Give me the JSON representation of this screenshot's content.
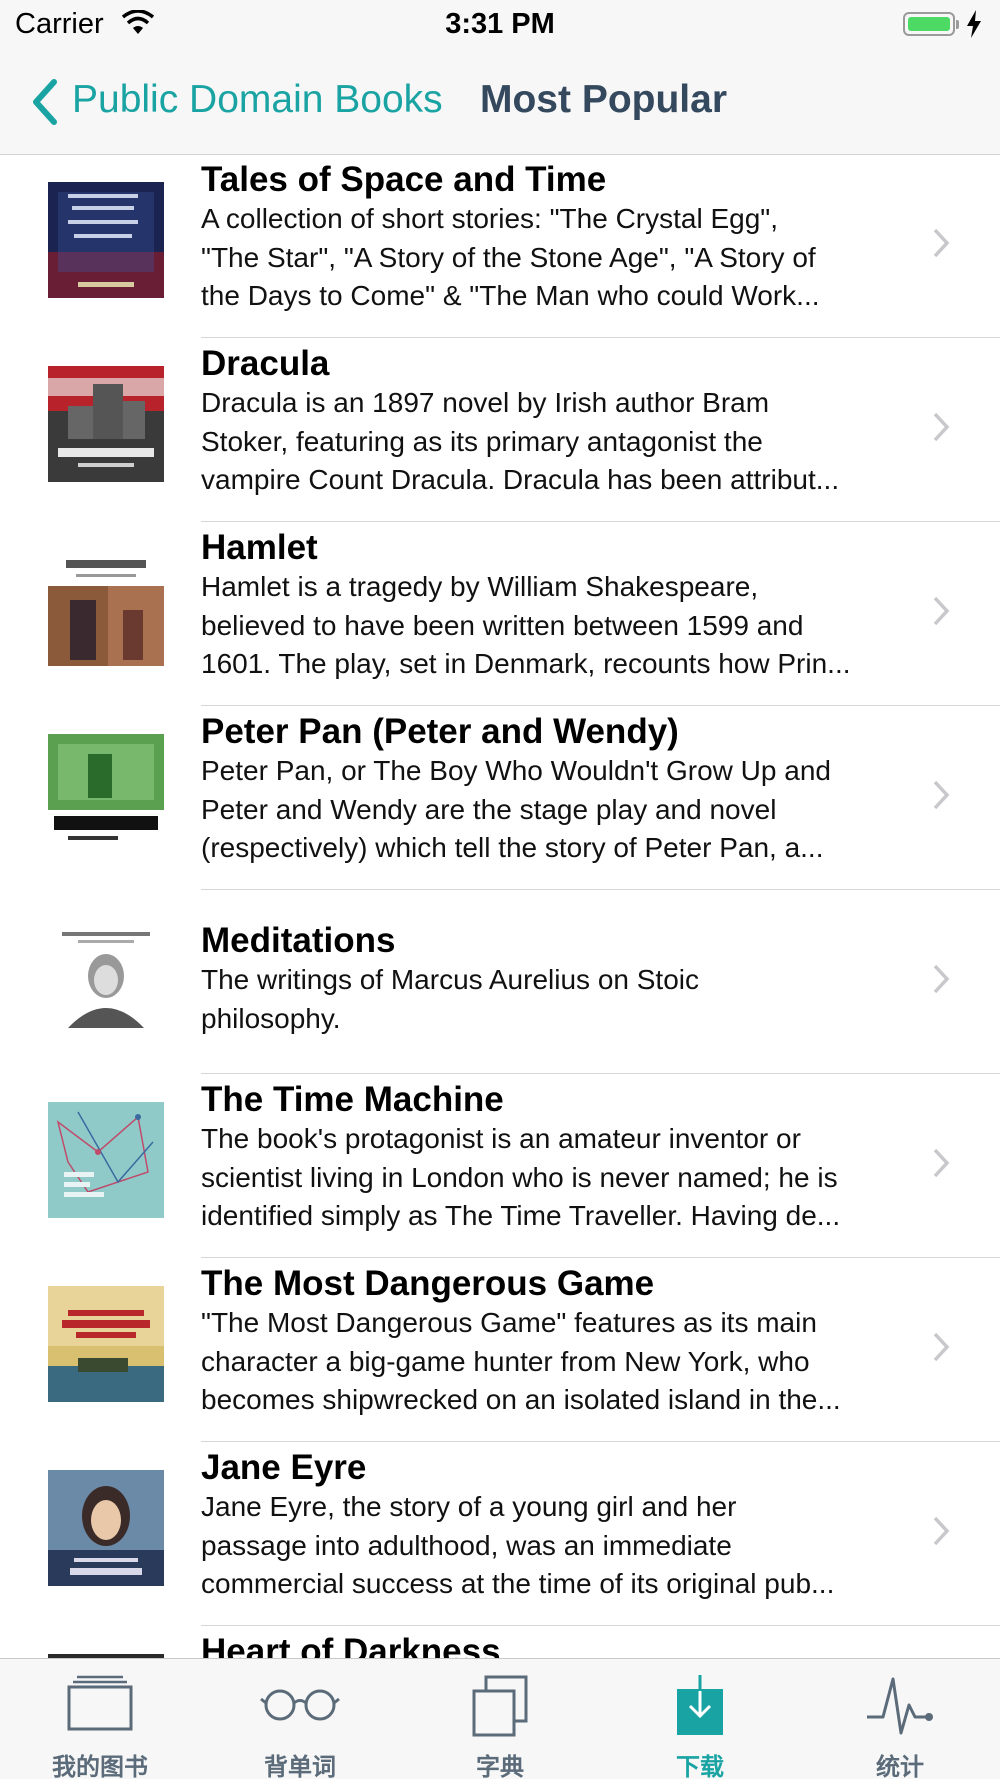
{
  "status_bar": {
    "carrier": "Carrier",
    "time": "3:31 PM"
  },
  "nav": {
    "back_label": "Public Domain Books",
    "title": "Most Popular"
  },
  "books": [
    {
      "title": "Tales of Space and Time",
      "desc": [
        "A collection of short stories: \"The Crystal Egg\",",
        "\"The Star\", \"A Story of the Stone Age\", \"A Story of",
        "the Days to Come\" & \"The Man who could Work..."
      ],
      "cover": "tales-cover"
    },
    {
      "title": "Dracula",
      "desc": [
        "Dracula is an 1897 novel by Irish author Bram",
        "Stoker, featuring as its primary antagonist the",
        "vampire Count Dracula. Dracula has been attribut..."
      ],
      "cover": "dracula-cover"
    },
    {
      "title": "Hamlet",
      "desc": [
        "Hamlet is a tragedy by William Shakespeare,",
        "believed to have been written between 1599 and",
        "1601. The play, set in Denmark, recounts how Prin..."
      ],
      "cover": "hamlet-cover"
    },
    {
      "title": "Peter Pan (Peter and Wendy)",
      "desc": [
        "Peter Pan, or The Boy Who Wouldn't Grow Up and",
        "Peter and Wendy are the stage play and novel",
        "(respectively) which tell the story of Peter Pan, a..."
      ],
      "cover": "peterpan-cover"
    },
    {
      "title": "Meditations",
      "desc": [
        "The writings of Marcus Aurelius on Stoic",
        "philosophy."
      ],
      "cover": "meditations-cover"
    },
    {
      "title": "The Time Machine",
      "desc": [
        "The book's protagonist is an amateur inventor or",
        "scientist living in London who is never named; he is",
        "identified simply as The Time Traveller. Having de..."
      ],
      "cover": "timemachine-cover"
    },
    {
      "title": "The Most Dangerous Game",
      "desc": [
        "\"The Most Dangerous Game\" features as its main",
        "character a big-game hunter from New York, who",
        "becomes shipwrecked on an isolated island in the..."
      ],
      "cover": "dangerousgame-cover"
    },
    {
      "title": "Jane Eyre",
      "desc": [
        "Jane Eyre, the story of a young girl and her",
        "passage into adulthood, was an immediate",
        "commercial success at the time of its original pub..."
      ],
      "cover": "janeeyre-cover"
    },
    {
      "title": "Heart of Darkness",
      "desc": [],
      "cover": "heartofdarkness-cover"
    }
  ],
  "tabs": [
    {
      "label": "我的图书",
      "icon": "books-icon",
      "active": false
    },
    {
      "label": "背单词",
      "icon": "glasses-icon",
      "active": false
    },
    {
      "label": "字典",
      "icon": "dictionary-icon",
      "active": false
    },
    {
      "label": "下载",
      "icon": "download-icon",
      "active": true
    },
    {
      "label": "统计",
      "icon": "stats-icon",
      "active": false
    }
  ],
  "colors": {
    "accent": "#1aa3a3",
    "nav_title": "#34495e",
    "battery": "#4cd964"
  }
}
